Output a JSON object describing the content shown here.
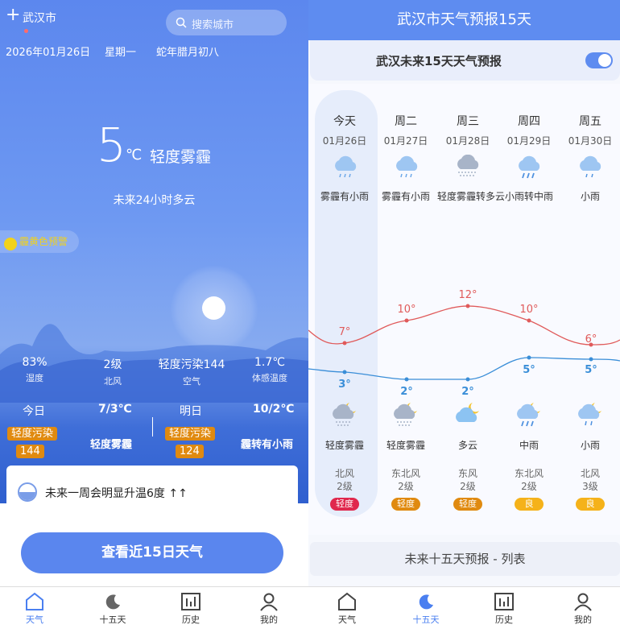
{
  "left": {
    "city": "武汉市",
    "search_placeholder": "搜索城市",
    "date": "2026年01月26日",
    "weekday": "星期一",
    "lunar": "蛇年腊月初八",
    "temp": "5",
    "unit": "℃",
    "condition": "轻度雾霾",
    "future": "未来24小时多云",
    "warning": "霾黄色预警",
    "stats": [
      {
        "value": "83%",
        "label": "湿度"
      },
      {
        "value": "2级",
        "label": "北风"
      },
      {
        "value": "轻度污染144",
        "label": "空气"
      },
      {
        "value": "1.7℃",
        "label": "体感温度"
      }
    ],
    "today": {
      "label": "今日",
      "range": "7/3℃",
      "aq": "轻度污染",
      "aqi": "144",
      "cond": "轻度雾霾"
    },
    "tomorrow": {
      "label": "明日",
      "range": "10/2℃",
      "aq": "轻度污染",
      "aqi": "124",
      "cond": "霾转有小雨"
    },
    "notice": "未来一周会明显升温6度 ↑↑",
    "button": "查看近15日天气"
  },
  "right": {
    "header": "武汉市天气预报15天",
    "subheader": "武汉未来15天天气预报",
    "list_button": "未来十五天预报 - 列表",
    "days": [
      {
        "name": "今天",
        "date": "01月26日",
        "day_cond": "雾霾有小雨",
        "high": "7°",
        "low": "3°",
        "night_cond": "轻度雾霾",
        "wind": "北风",
        "level": "2级",
        "aq": "轻度",
        "aq_color": "#e0284d"
      },
      {
        "name": "周二",
        "date": "01月27日",
        "day_cond": "雾霾有小雨",
        "high": "10°",
        "low": "2°",
        "night_cond": "轻度雾霾",
        "wind": "东北风",
        "level": "2级",
        "aq": "轻度",
        "aq_color": "#e08a10"
      },
      {
        "name": "周三",
        "date": "01月28日",
        "day_cond": "轻度雾霾转多云",
        "high": "12°",
        "low": "2°",
        "night_cond": "多云",
        "wind": "东风",
        "level": "2级",
        "aq": "轻度",
        "aq_color": "#e08a10"
      },
      {
        "name": "周四",
        "date": "01月29日",
        "day_cond": "小雨转中雨",
        "high": "10°",
        "low": "5°",
        "night_cond": "中雨",
        "wind": "东北风",
        "level": "2级",
        "aq": "良",
        "aq_color": "#f5b21a"
      },
      {
        "name": "周五",
        "date": "01月30日",
        "day_cond": "小雨",
        "high": "6°",
        "low": "5°",
        "night_cond": "小雨",
        "wind": "北风",
        "level": "3级",
        "aq": "良",
        "aq_color": "#f5b21a"
      }
    ]
  },
  "tabs": [
    {
      "label": "天气",
      "icon": "home-icon"
    },
    {
      "label": "十五天",
      "icon": "moon-icon"
    },
    {
      "label": "历史",
      "icon": "chart-icon"
    },
    {
      "label": "我的",
      "icon": "user-icon"
    }
  ]
}
